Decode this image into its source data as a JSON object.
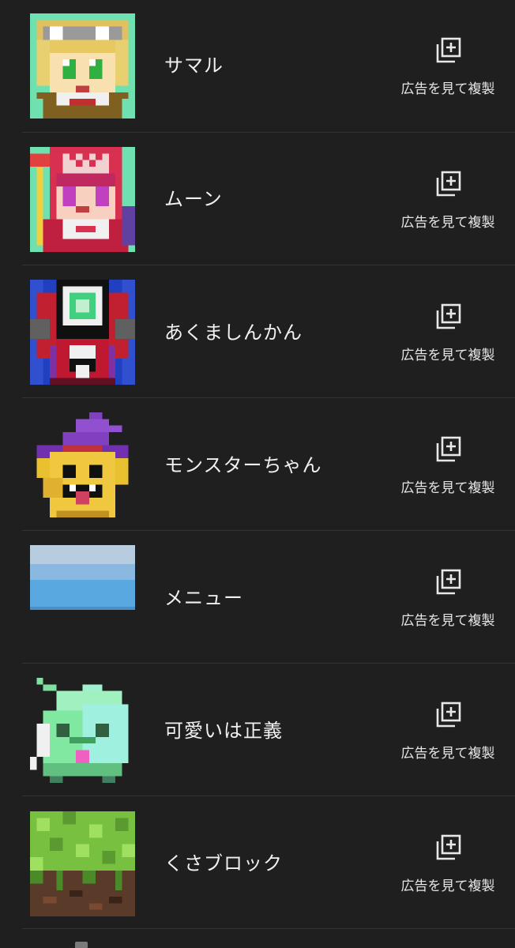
{
  "items": [
    {
      "name": "サマル",
      "action_label": "広告を見て複製",
      "icon": "duplicate-icon"
    },
    {
      "name": "ムーン",
      "action_label": "広告を見て複製",
      "icon": "duplicate-icon"
    },
    {
      "name": "あくましんかん",
      "action_label": "広告を見て複製",
      "icon": "duplicate-icon"
    },
    {
      "name": "モンスターちゃん",
      "action_label": "広告を見て複製",
      "icon": "duplicate-icon"
    },
    {
      "name": "メニュー",
      "action_label": "広告を見て複製",
      "icon": "duplicate-icon"
    },
    {
      "name": "可愛いは正義",
      "action_label": "広告を見て複製",
      "icon": "duplicate-icon"
    },
    {
      "name": "くさブロック",
      "action_label": "広告を見て複製",
      "icon": "duplicate-icon"
    }
  ],
  "colors": {
    "background": "#1f1f1f",
    "separator": "#333333",
    "text": "#f0f0f0"
  }
}
